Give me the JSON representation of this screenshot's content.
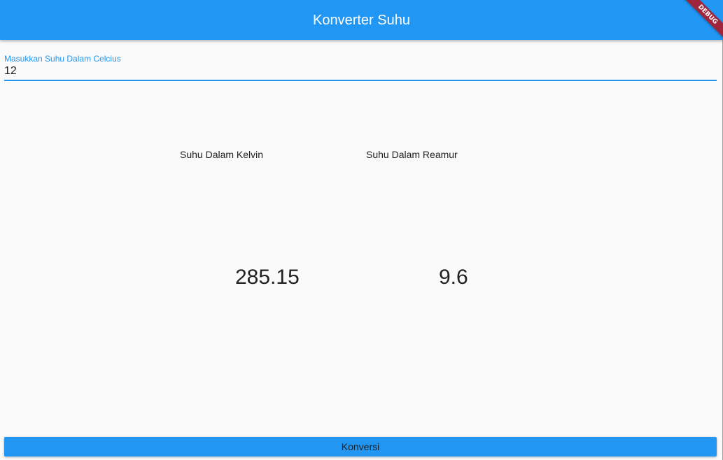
{
  "app_bar": {
    "title": "Konverter Suhu",
    "color": "#2196f3"
  },
  "debug_banner": {
    "label": "DEBUG",
    "color": "#a0243c"
  },
  "celsius_input": {
    "label": "Masukkan Suhu Dalam Celcius",
    "value": "12"
  },
  "results": {
    "kelvin": {
      "label": "Suhu Dalam Kelvin",
      "value": "285.15"
    },
    "reamur": {
      "label": "Suhu Dalam Reamur",
      "value": "9.6"
    }
  },
  "convert_button": {
    "label": "Konversi"
  }
}
